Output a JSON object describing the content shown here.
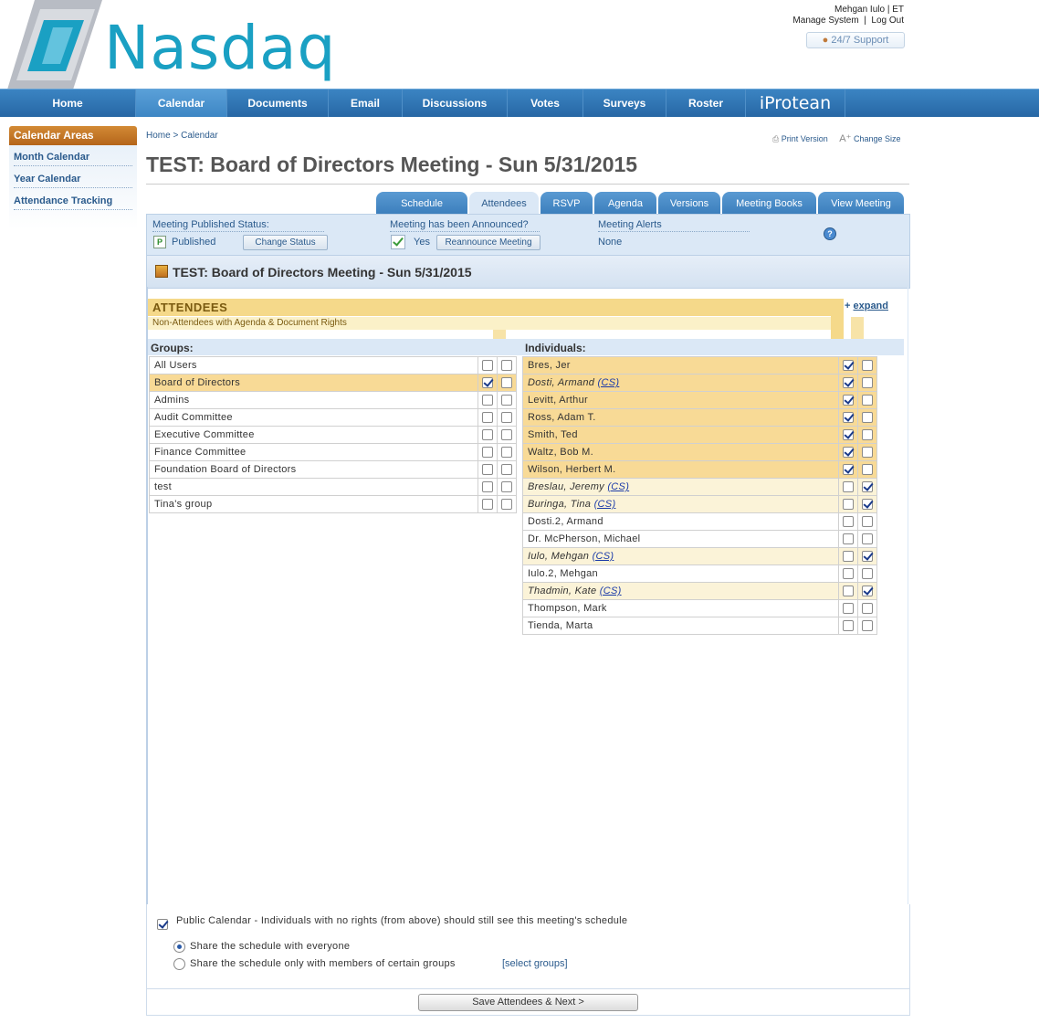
{
  "header": {
    "logo_text": "Nasdaq",
    "user_name": "Mehgan Iulo",
    "timezone": "ET",
    "manage_system": "Manage System",
    "log_out": "Log Out",
    "support": "24/7 Support"
  },
  "nav": {
    "items": [
      "Home",
      "Calendar",
      "Documents",
      "Email",
      "Discussions",
      "Votes",
      "Surveys",
      "Roster"
    ],
    "active": "Calendar",
    "brand": "iProtean"
  },
  "sidebar": {
    "title": "Calendar Areas",
    "items": [
      "Month Calendar",
      "Year Calendar",
      "Attendance Tracking"
    ]
  },
  "breadcrumb": {
    "home": "Home",
    "sep": ">",
    "current": "Calendar"
  },
  "tools": {
    "print": "Print Version",
    "change_size": "Change Size"
  },
  "page_title": "TEST: Board of Directors Meeting - Sun 5/31/2015",
  "tabs": [
    "Schedule",
    "Attendees",
    "RSVP",
    "Agenda",
    "Versions",
    "Meeting Books",
    "View Meeting"
  ],
  "active_tab": "Attendees",
  "status": {
    "published_label": "Meeting Published Status:",
    "published_value": "Published",
    "change_status": "Change Status",
    "announced_label": "Meeting has been Announced?",
    "announced_value": "Yes",
    "reannounce": "Reannounce Meeting",
    "alerts_label": "Meeting Alerts",
    "alerts_value": "None"
  },
  "meeting_bar_title": "TEST: Board of Directors Meeting - Sun 5/31/2015",
  "attendees": {
    "title": "ATTENDEES",
    "subtitle": "Non-Attendees with Agenda & Document Rights",
    "expand": "expand",
    "groups_label": "Groups:",
    "individuals_label": "Individuals:",
    "groups": [
      {
        "name": "All Users",
        "attendee": false,
        "rights": false,
        "highlight": false
      },
      {
        "name": "Board of Directors",
        "attendee": true,
        "rights": false,
        "highlight": true
      },
      {
        "name": "Admins",
        "attendee": false,
        "rights": false,
        "highlight": false
      },
      {
        "name": "Audit Committee",
        "attendee": false,
        "rights": false,
        "highlight": false
      },
      {
        "name": "Executive Committee",
        "attendee": false,
        "rights": false,
        "highlight": false
      },
      {
        "name": "Finance Committee",
        "attendee": false,
        "rights": false,
        "highlight": false
      },
      {
        "name": "Foundation Board of Directors",
        "attendee": false,
        "rights": false,
        "highlight": false
      },
      {
        "name": "test",
        "attendee": false,
        "rights": false,
        "highlight": false
      },
      {
        "name": "Tina's group",
        "attendee": false,
        "rights": false,
        "highlight": false
      }
    ],
    "individuals": [
      {
        "name": "Bres, Jer",
        "cs": false,
        "italic": false,
        "attendee": true,
        "rights": false,
        "style": "hl"
      },
      {
        "name": "Dosti, Armand",
        "cs": true,
        "italic": true,
        "attendee": true,
        "rights": false,
        "style": "hl"
      },
      {
        "name": "Levitt, Arthur",
        "cs": false,
        "italic": false,
        "attendee": true,
        "rights": false,
        "style": "hl"
      },
      {
        "name": "Ross, Adam T.",
        "cs": false,
        "italic": false,
        "attendee": true,
        "rights": false,
        "style": "hl"
      },
      {
        "name": "Smith, Ted",
        "cs": false,
        "italic": false,
        "attendee": true,
        "rights": false,
        "style": "hl"
      },
      {
        "name": "Waltz, Bob M.",
        "cs": false,
        "italic": false,
        "attendee": true,
        "rights": false,
        "style": "hl"
      },
      {
        "name": "Wilson, Herbert M.",
        "cs": false,
        "italic": false,
        "attendee": true,
        "rights": false,
        "style": "hl"
      },
      {
        "name": "Breslau, Jeremy",
        "cs": true,
        "italic": true,
        "attendee": false,
        "rights": true,
        "style": "hl2"
      },
      {
        "name": "Buringa, Tina",
        "cs": true,
        "italic": true,
        "attendee": false,
        "rights": true,
        "style": "hl2"
      },
      {
        "name": "Dosti.2, Armand",
        "cs": false,
        "italic": false,
        "attendee": false,
        "rights": false,
        "style": ""
      },
      {
        "name": "Dr. McPherson, Michael",
        "cs": false,
        "italic": false,
        "attendee": false,
        "rights": false,
        "style": ""
      },
      {
        "name": "Iulo, Mehgan",
        "cs": true,
        "italic": true,
        "attendee": false,
        "rights": true,
        "style": "hl2"
      },
      {
        "name": "Iulo.2, Mehgan",
        "cs": false,
        "italic": false,
        "attendee": false,
        "rights": false,
        "style": ""
      },
      {
        "name": "Thadmin, Kate",
        "cs": true,
        "italic": true,
        "attendee": false,
        "rights": true,
        "style": "hl2"
      },
      {
        "name": "Thompson, Mark",
        "cs": false,
        "italic": false,
        "attendee": false,
        "rights": false,
        "style": ""
      },
      {
        "name": "Tienda, Marta",
        "cs": false,
        "italic": false,
        "attendee": false,
        "rights": false,
        "style": ""
      }
    ],
    "cs_label": "(CS)"
  },
  "public_calendar": {
    "checked": true,
    "text": "Public Calendar - Individuals with no rights (from above) should still see this meeting's schedule",
    "option_everyone": "Share the schedule with everyone",
    "option_groups": "Share the schedule only with members of certain groups",
    "select_groups": "[select groups]",
    "selected": "everyone"
  },
  "save_button": "Save Attendees & Next >",
  "colors": {
    "brand": "#1aa0c3",
    "nav": "#2767a4",
    "attendee_highlight": "#f8da96",
    "rights_highlight": "#fbf3d8"
  }
}
